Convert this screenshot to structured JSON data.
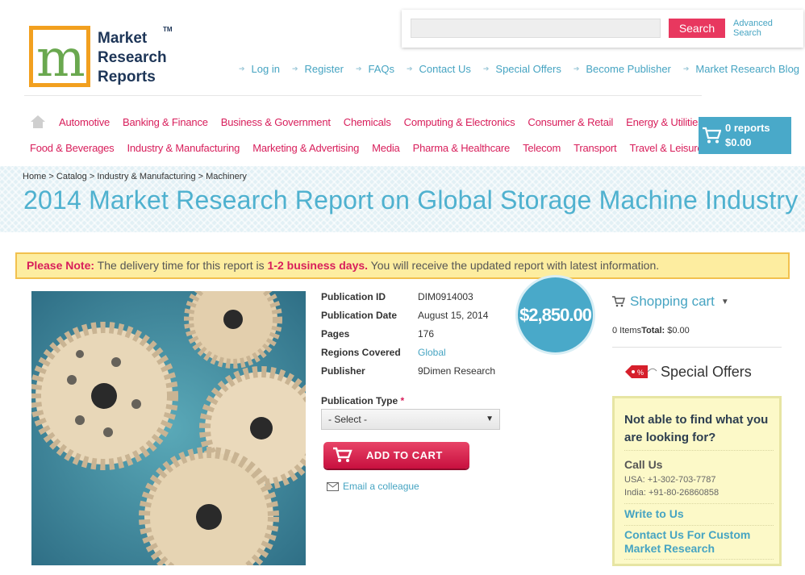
{
  "logo": {
    "line1": "Market",
    "line2": "Research",
    "line3": "Reports",
    "tm": "TM",
    "letter": "m"
  },
  "search": {
    "placeholder": "",
    "button_label": "Search",
    "advanced_line1": "Advanced",
    "advanced_line2": "Search"
  },
  "top_links": [
    "Log in",
    "Register",
    "FAQs",
    "Contact Us",
    "Special Offers",
    "Become Publisher",
    "Market Research Blog"
  ],
  "categories_row1": [
    "Automotive",
    "Banking & Finance",
    "Business & Government",
    "Chemicals",
    "Computing & Electronics",
    "Consumer & Retail",
    "Energy & Utilities"
  ],
  "categories_row2": [
    "Food & Beverages",
    "Industry & Manufacturing",
    "Marketing & Advertising",
    "Media",
    "Pharma & Healthcare",
    "Telecom",
    "Transport",
    "Travel & Leisure"
  ],
  "cart": {
    "count": "0 reports",
    "total": "$0.00"
  },
  "breadcrumb": "Home > Catalog > Industry & Manufacturing > Machinery",
  "page_title": "2014 Market Research Report on Global Storage Machine Industry",
  "note": {
    "label": "Please Note:",
    "text1": " The delivery time for this report is ",
    "highlight": "1-2 business days.",
    "text2": " You will receive the updated report with latest information."
  },
  "details": {
    "pub_id_label": "Publication ID",
    "pub_id": "DIM0914003",
    "pub_date_label": "Publication Date",
    "pub_date": "August 15, 2014",
    "pages_label": "Pages",
    "pages": "176",
    "regions_label": "Regions Covered",
    "regions": "Global",
    "publisher_label": "Publisher",
    "publisher": "9Dimen Research"
  },
  "price": "$2,850.00",
  "pub_type": {
    "label": "Publication Type",
    "required": "*",
    "selected": "- Select -"
  },
  "add_to_cart_label": "ADD TO CART",
  "email_colleague": "Email a colleague",
  "shopping_cart": {
    "title": "Shopping cart",
    "items": "0 Items",
    "total_label": "Total:",
    "total": "$0.00"
  },
  "special_offers": "Special Offers",
  "help": {
    "question": "Not able to find what you are looking for?",
    "call_us": "Call Us",
    "usa": "USA: +1-302-703-7787",
    "india": "India: +91-80-26860858",
    "write_to_us": "Write to Us",
    "custom": "Contact Us For Custom Market Research"
  },
  "colors": {
    "accent_blue": "#49a9c9",
    "accent_pink": "#d81e5b",
    "note_bg": "#fdeda0"
  }
}
